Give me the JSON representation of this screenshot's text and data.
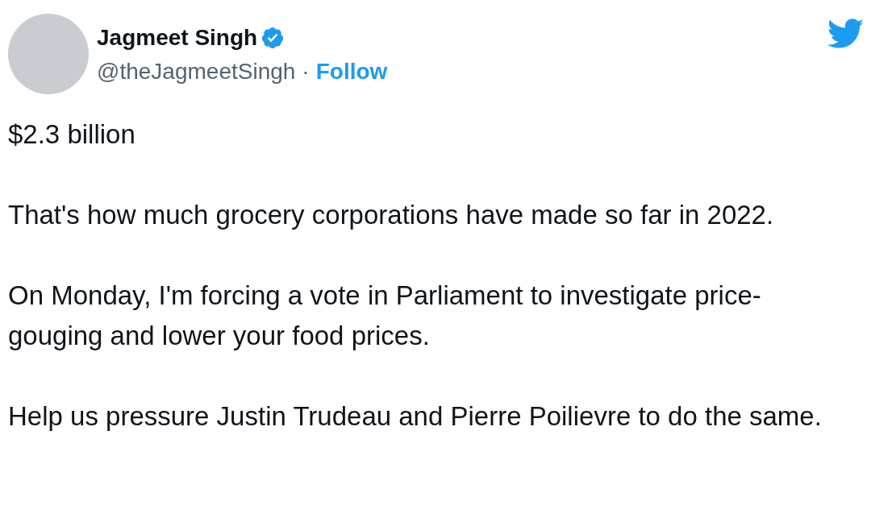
{
  "author": {
    "name": "Jagmeet Singh",
    "verified": true,
    "handle": "@theJagmeetSingh",
    "separator": "·",
    "follow": "Follow"
  },
  "paragraphs": [
    "$2.3 billion",
    "That's how much grocery corporations have made so far in 2022.",
    "On Monday, I'm forcing a vote in Parliament to investigate price-gouging and lower your food prices.",
    "Help us pressure Justin Trudeau and Pierre Poilievre to do the same."
  ]
}
